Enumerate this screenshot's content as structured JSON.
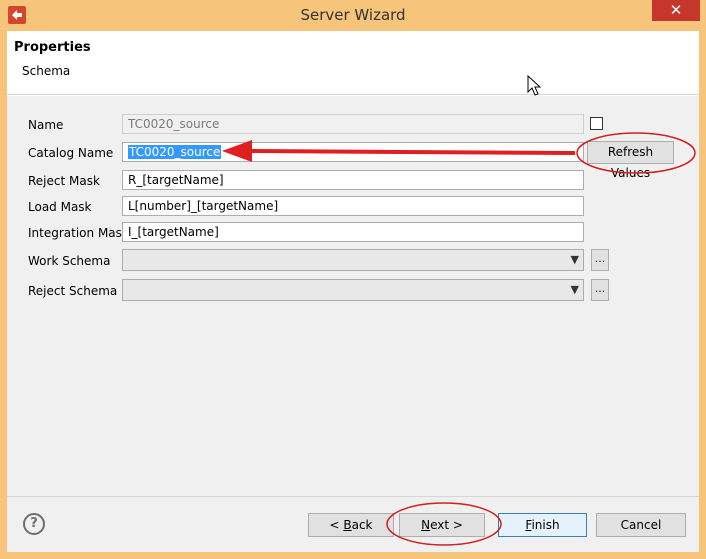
{
  "window": {
    "title": "Server Wizard",
    "close_label": "✕"
  },
  "header": {
    "title": "Properties",
    "subtitle": "Schema"
  },
  "form": {
    "name_label": "Name",
    "name_value": "TC0020_source",
    "catalog_label": "Catalog Name",
    "catalog_value": "TC0020_source",
    "reject_mask_label": "Reject Mask",
    "reject_mask_value": "R_[targetName]",
    "load_mask_label": "Load Mask",
    "load_mask_value": "L[number]_[targetName]",
    "integration_mask_label": "Integration Mask",
    "integration_mask_value": "I_[targetName]",
    "work_schema_label": "Work Schema",
    "reject_schema_label": "Reject Schema",
    "refresh_label": "Refresh Values",
    "browse_label": "..."
  },
  "footer": {
    "help_label": "?",
    "back_arrow": "< ",
    "back_key": "B",
    "back_rest": "ack",
    "next_key": "N",
    "next_rest": "ext >",
    "finish_key": "F",
    "finish_rest": "inish",
    "cancel_label": "Cancel"
  },
  "colors": {
    "frame": "#f6c47a",
    "close": "#c7362b",
    "annotation": "#e02020",
    "selection": "#3399ff"
  }
}
